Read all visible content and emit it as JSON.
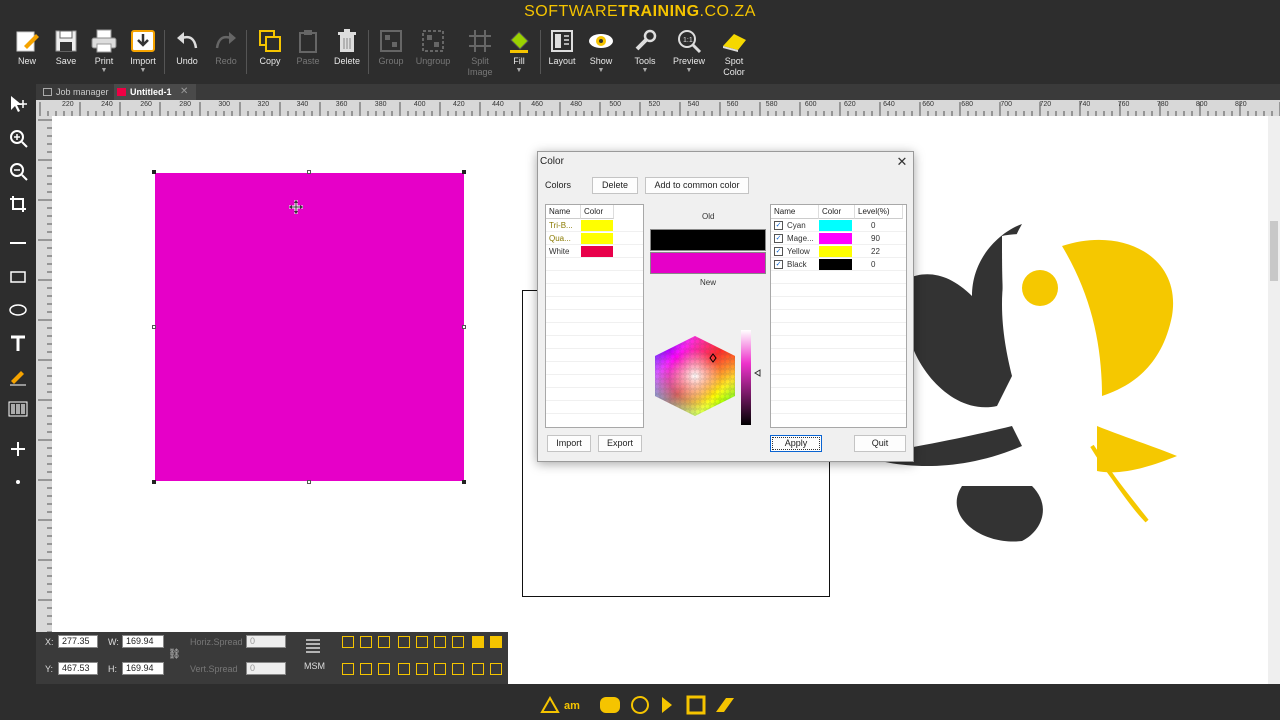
{
  "banner": {
    "prefix": "SOFTWARE",
    "bold": "TRAINING",
    "suffix": ".CO.ZA"
  },
  "toolbar": {
    "new": "New",
    "save": "Save",
    "print": "Print",
    "import": "Import",
    "undo": "Undo",
    "redo": "Redo",
    "copy": "Copy",
    "paste": "Paste",
    "delete": "Delete",
    "group": "Group",
    "ungroup": "Ungroup",
    "split_image_1": "Split",
    "split_image_2": "Image",
    "fill": "Fill",
    "layout": "Layout",
    "show": "Show",
    "tools": "Tools",
    "preview": "Preview",
    "spot_color_1": "Spot",
    "spot_color_2": "Color"
  },
  "tabs": {
    "job_manager": "Job manager",
    "untitled": "Untitled-1"
  },
  "rulers": {
    "horizontal": [
      "220",
      "240",
      "260",
      "280",
      "300",
      "320",
      "340",
      "360",
      "380",
      "400",
      "420",
      "440",
      "460",
      "480",
      "500",
      "520",
      "540",
      "560",
      "580",
      "600",
      "620",
      "640",
      "660",
      "680",
      "700",
      "720",
      "740",
      "760",
      "780",
      "800",
      "820"
    ],
    "vertical": [
      "220",
      "240",
      "260",
      "280",
      "300",
      "320",
      "340",
      "360",
      "380",
      "400",
      "420",
      "440",
      "460",
      "480",
      "500",
      "520",
      "540",
      "560",
      "580",
      "600",
      "620",
      "640",
      "660",
      "680"
    ]
  },
  "bottom": {
    "x_label": "X:",
    "x_value": "277.35",
    "y_label": "Y:",
    "y_value": "467.53",
    "w_label": "W:",
    "w_value": "169.94",
    "h_label": "H:",
    "h_value": "169.94",
    "horiz_spread_label": "Horiz.Spread",
    "horiz_spread_value": "0",
    "vert_spread_label": "Vert.Spread",
    "vert_spread_value": "0",
    "msm_label": "MSM"
  },
  "dialog": {
    "title": "Color",
    "colors_label": "Colors",
    "delete_btn": "Delete",
    "add_common_btn": "Add to common color",
    "left_list": {
      "headers": [
        "Name",
        "Color"
      ],
      "rows": [
        {
          "name": "Tri-B...",
          "color": "#ffff00"
        },
        {
          "name": "Qua...",
          "color": "#ffff00"
        },
        {
          "name": "White",
          "color": "#e8004a"
        }
      ]
    },
    "old_label": "Old",
    "new_label": "New",
    "old_color": "#000000",
    "new_color": "#e600c8",
    "right_list": {
      "headers": [
        "Name",
        "Color",
        "Level(%)"
      ],
      "rows": [
        {
          "name": "Cyan",
          "color": "#00ffff",
          "level": "0",
          "checked": "✓"
        },
        {
          "name": "Mage...",
          "color": "#ff00ff",
          "level": "90",
          "checked": "✓"
        },
        {
          "name": "Yellow",
          "color": "#ffff00",
          "level": "22",
          "checked": "✓"
        },
        {
          "name": "Black",
          "color": "#000000",
          "level": "0",
          "checked": "✓"
        }
      ]
    },
    "import_btn": "Import",
    "export_btn": "Export",
    "apply_btn": "Apply",
    "quit_btn": "Quit"
  },
  "colors": {
    "accent": "#f5c400",
    "magenta": "#e600c8",
    "dark": "#2d2d2d",
    "logo_dark": "#333333",
    "logo_yellow": "#f5c800"
  }
}
